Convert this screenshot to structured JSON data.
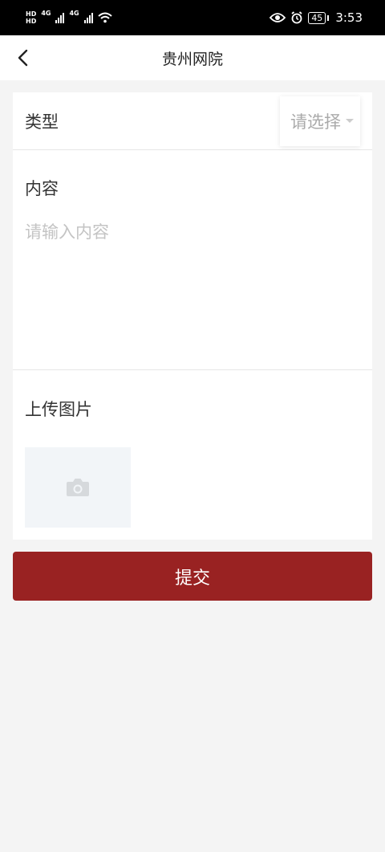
{
  "status_bar": {
    "hd1": "HD",
    "hd2": "HD",
    "net1": "4G",
    "net2": "4G",
    "battery": "45",
    "time": "3:53"
  },
  "header": {
    "title": "贵州网院",
    "back_icon": "chevron-left-icon"
  },
  "form": {
    "type_label": "类型",
    "type_select_placeholder": "请选择",
    "content_label": "内容",
    "content_placeholder": "请输入内容",
    "content_value": "",
    "upload_label": "上传图片",
    "upload_icon": "camera-icon"
  },
  "submit_label": "提交",
  "colors": {
    "primary": "#992222",
    "background": "#f4f4f4",
    "placeholder": "#c4c4c4",
    "upload_bg": "#f2f5f8"
  }
}
